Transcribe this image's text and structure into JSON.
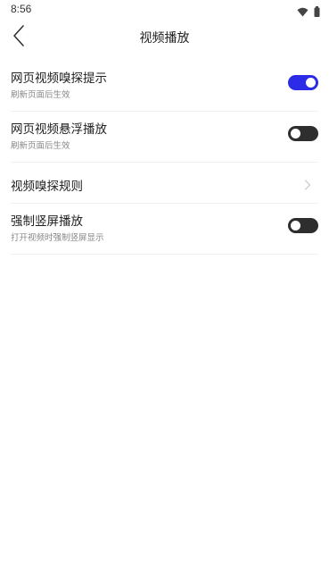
{
  "status_bar": {
    "time": "8:56",
    "icons": [
      "wifi-icon",
      "battery-icon"
    ]
  },
  "app_bar": {
    "title": "视频播放",
    "back_icon": "back-arrow-icon"
  },
  "settings": [
    {
      "title": "网页视频嗅探提示",
      "subtitle": "刷新页面后生效",
      "control": "toggle",
      "on": true
    },
    {
      "title": "网页视频悬浮播放",
      "subtitle": "刷新页面后生效",
      "control": "toggle",
      "on": false
    },
    {
      "title": "视频嗅探规则",
      "control": "chevron",
      "icon": "chevron-right-icon"
    },
    {
      "title": "强制竖屏播放",
      "subtitle": "打开视频时强制竖屏显示",
      "control": "toggle",
      "on": false
    }
  ],
  "colors": {
    "toggle_on": "#2b2be8",
    "toggle_off": "#2e2e2e",
    "divider": "#f0f0f0",
    "subtitle": "#888888"
  }
}
